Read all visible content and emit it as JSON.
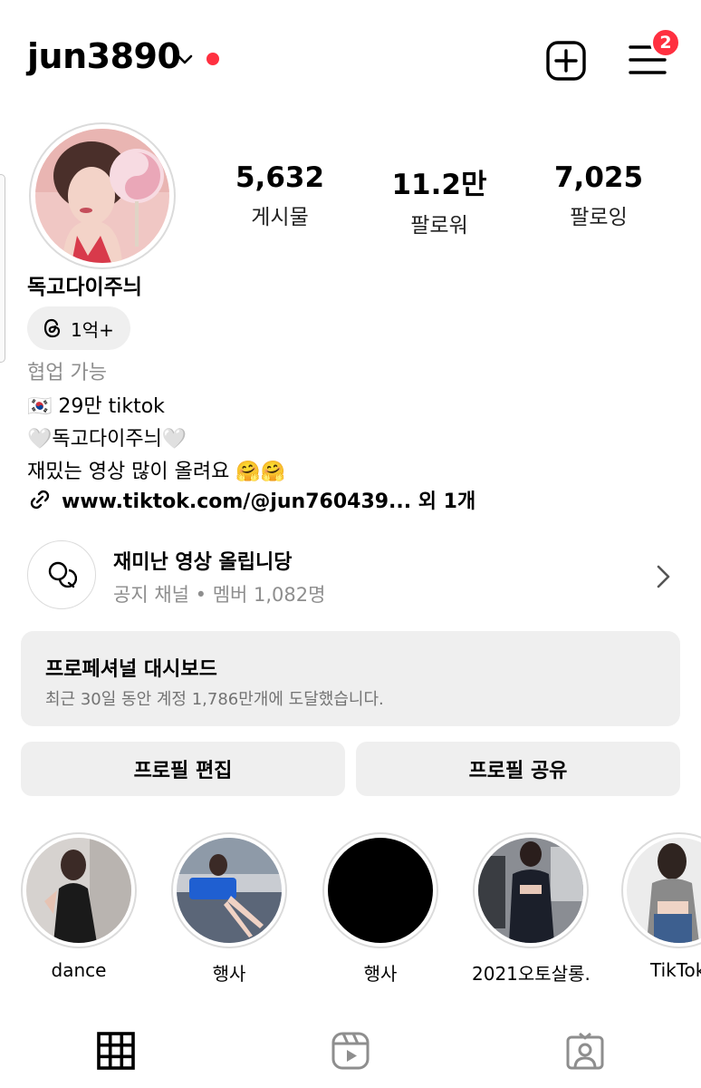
{
  "header": {
    "username": "jun3890",
    "notification_badge": "2",
    "accent_color": "#ff3040"
  },
  "profile": {
    "stats": [
      {
        "value": "5,632",
        "label": "게시물"
      },
      {
        "value": "11.2만",
        "label": "팔로워"
      },
      {
        "value": "7,025",
        "label": "팔로잉"
      }
    ],
    "display_name": "독고다이주늬",
    "threads_count": "1억+",
    "category": "협업 가능",
    "bio": [
      "🇰🇷 29만 tiktok",
      "🤍독고다이주늬🤍",
      "재밌는 영상 많이 올려요 🤗🤗"
    ],
    "link": "www.tiktok.com/@jun760439... 외 1개"
  },
  "channel": {
    "title": "재미난 영상 올립니당",
    "subtitle": "공지 채널 • 멤버 1,082명"
  },
  "dashboard": {
    "title": "프로페셔널 대시보드",
    "subtitle": "최근 30일 동안 계정 1,786만개에 도달했습니다."
  },
  "buttons": {
    "edit_profile": "프로필 편집",
    "share_profile": "프로필 공유"
  },
  "highlights": [
    {
      "label": "dance"
    },
    {
      "label": "행사"
    },
    {
      "label": "행사"
    },
    {
      "label": "2021오토살롱..."
    },
    {
      "label": "TikTok"
    }
  ],
  "tabs": [
    "grid-icon",
    "reels-icon",
    "tagged-icon"
  ]
}
